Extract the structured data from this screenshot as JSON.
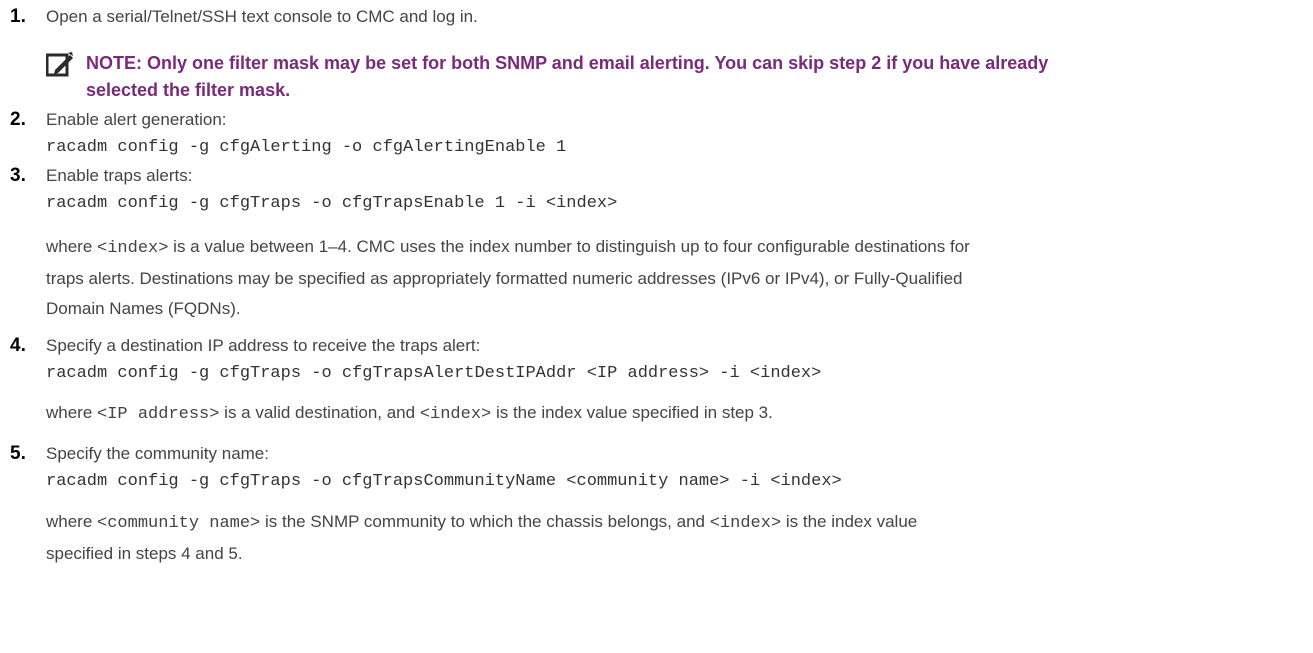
{
  "steps": [
    {
      "number": "1.",
      "text": "Open a serial/Telnet/SSH text console to CMC and log in."
    },
    {
      "number": "2.",
      "text": "Enable alert generation:",
      "code": "racadm config -g cfgAlerting -o cfgAlertingEnable 1"
    },
    {
      "number": "3.",
      "text": "Enable traps alerts:",
      "code": "racadm config -g cfgTraps -o cfgTrapsEnable 1 -i <index>",
      "desc": {
        "pre": "where ",
        "mono1": "<index>",
        "post": " is a value between 1–4. CMC uses the index number to distinguish up to four configurable destinations for",
        "line2": "traps alerts. Destinations may be specified as appropriately formatted numeric addresses (IPv6 or IPv4), or Fully-Qualified",
        "line3": "Domain Names (FQDNs)."
      }
    },
    {
      "number": "4.",
      "text": "Specify a destination IP address to receive the traps alert:",
      "code": "racadm config -g cfgTraps -o cfgTrapsAlertDestIPAddr <IP address> -i <index>",
      "desc": {
        "pre": "where ",
        "mono1": "<IP address>",
        "mid": " is a valid destination, and ",
        "mono2": "<index>",
        "post": " is the index value specified in step 3."
      }
    },
    {
      "number": "5.",
      "text": "Specify the community name:",
      "code": "racadm config -g cfgTraps -o cfgTrapsCommunityName <community name> -i <index>",
      "desc": {
        "pre": "where ",
        "mono1": "<community name>",
        "mid": "  is the SNMP community to which the chassis belongs, and ",
        "mono2": "<index>",
        "post": " is the index value",
        "line2": "specified in steps 4 and 5."
      }
    }
  ],
  "note": {
    "icon": "note-pencil-icon",
    "line1": "NOTE: Only one filter mask may be set for both SNMP and email alerting. You can skip step 2 if you have already",
    "line2": "selected the filter mask."
  },
  "colors": {
    "note": "#7a2a7a",
    "text": "#444444",
    "number": "#000000"
  }
}
